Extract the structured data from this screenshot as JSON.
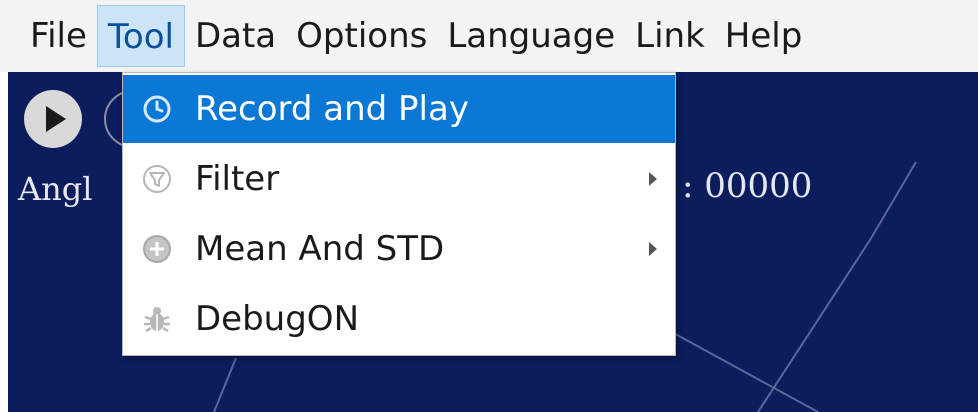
{
  "menubar": {
    "items": [
      {
        "label": "File"
      },
      {
        "label": "Tool"
      },
      {
        "label": "Data"
      },
      {
        "label": "Options"
      },
      {
        "label": "Language"
      },
      {
        "label": "Link"
      },
      {
        "label": "Help"
      }
    ],
    "active": "Tool"
  },
  "main": {
    "angle_label": "Angl",
    "readout": ":  00000"
  },
  "dropdown": {
    "items": [
      {
        "label": "Record and Play",
        "icon": "clock-history-icon",
        "submenu": false,
        "highlighted": true
      },
      {
        "label": "Filter",
        "icon": "filter-icon",
        "submenu": true,
        "highlighted": false
      },
      {
        "label": "Mean And STD",
        "icon": "plus-circle-icon",
        "submenu": true,
        "highlighted": false
      },
      {
        "label": "DebugON",
        "icon": "bug-icon",
        "submenu": false,
        "highlighted": false
      }
    ]
  },
  "colors": {
    "menubar_bg": "#f3f3f3",
    "active_menu_bg": "#cce4f7",
    "main_bg": "#0c1d5e",
    "highlight": "#0a78d4"
  }
}
